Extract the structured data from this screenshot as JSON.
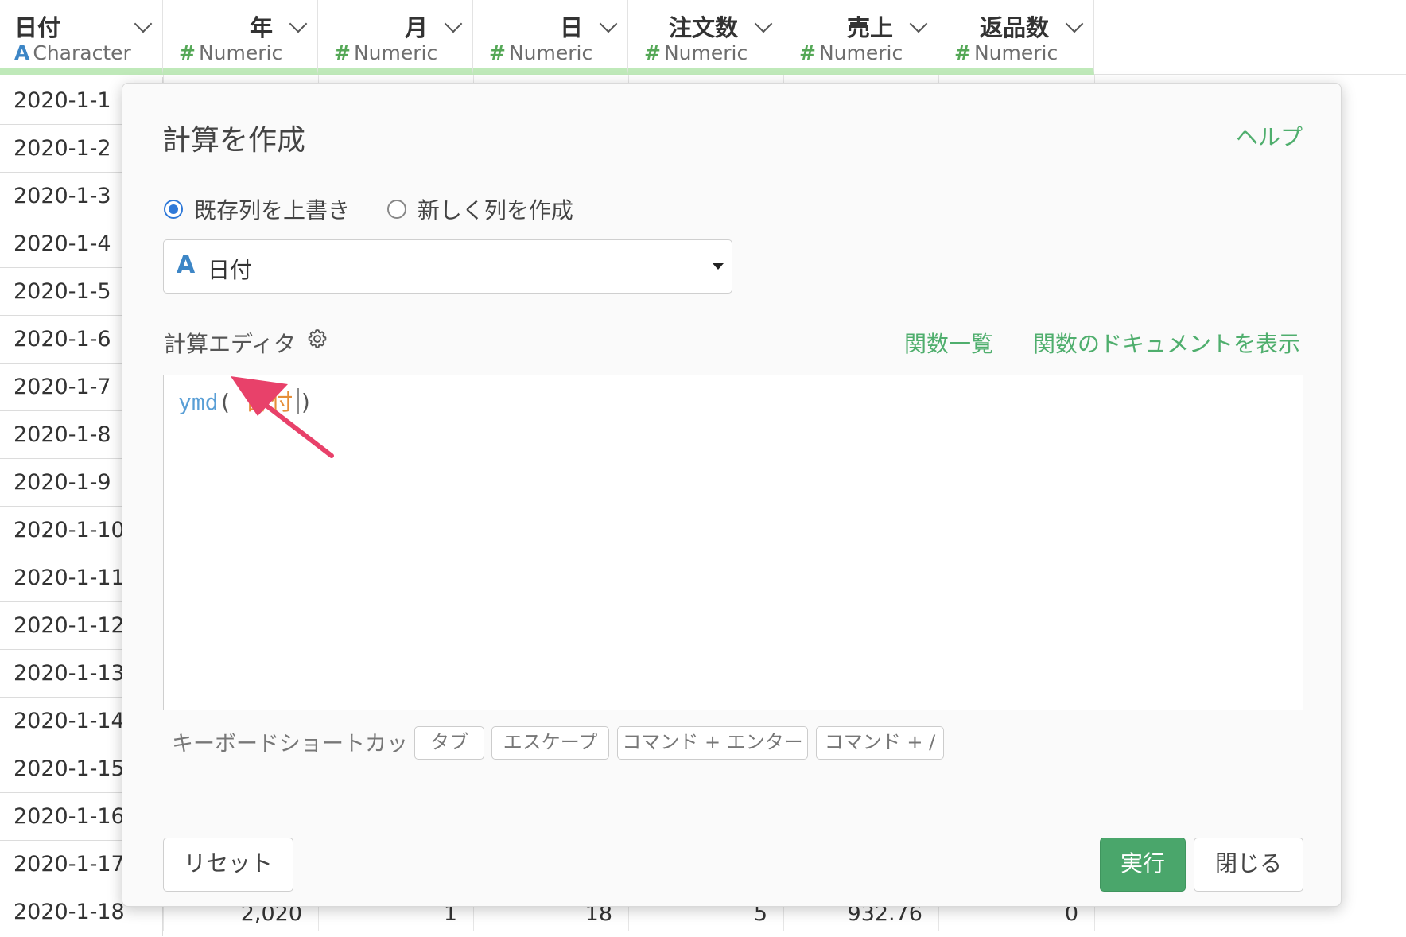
{
  "columns": [
    {
      "name": "日付",
      "type": "Character",
      "glyph": "A",
      "kind": "char"
    },
    {
      "name": "年",
      "type": "Numeric",
      "glyph": "#",
      "kind": "num"
    },
    {
      "name": "月",
      "type": "Numeric",
      "glyph": "#",
      "kind": "num"
    },
    {
      "name": "日",
      "type": "Numeric",
      "glyph": "#",
      "kind": "num"
    },
    {
      "name": "注文数",
      "type": "Numeric",
      "glyph": "#",
      "kind": "num"
    },
    {
      "name": "売上",
      "type": "Numeric",
      "glyph": "#",
      "kind": "num"
    },
    {
      "name": "返品数",
      "type": "Numeric",
      "glyph": "#",
      "kind": "num"
    }
  ],
  "rows": [
    "2020-1-1",
    "2020-1-2",
    "2020-1-3",
    "2020-1-4",
    "2020-1-5",
    "2020-1-6",
    "2020-1-7",
    "2020-1-8",
    "2020-1-9",
    "2020-1-10",
    "2020-1-11",
    "2020-1-12",
    "2020-1-13",
    "2020-1-14",
    "2020-1-15",
    "2020-1-16",
    "2020-1-17",
    "2020-1-18"
  ],
  "last_row_values": {
    "year": "2,020",
    "month": "1",
    "day": "18",
    "orders": "5",
    "sales": "932.76",
    "returns": "0"
  },
  "modal": {
    "title": "計算を作成",
    "help": "ヘルプ",
    "radio_overwrite": "既存列を上書き",
    "radio_new": "新しく列を作成",
    "selected_column_icon": "A",
    "selected_column": "日付",
    "editor_label": "計算エディタ",
    "func_list": "関数一覧",
    "func_doc": "関数のドキュメントを表示",
    "code_fn": "ymd",
    "code_open": "(",
    "code_arg": "日付",
    "code_close": ")",
    "shortcuts_label": "キーボードショートカット:",
    "kbd_tab": "タブ",
    "kbd_escape": "エスケープ",
    "kbd_cmd_enter": "コマンド + エンター",
    "kbd_cmd_slash": "コマンド + /",
    "reset": "リセット",
    "run": "実行",
    "close": "閉じる"
  },
  "colors": {
    "accent_green": "#4aa66b",
    "link_green": "#4fae6d",
    "annotation_arrow": "#e8416a",
    "radio_blue": "#2f79d8"
  }
}
